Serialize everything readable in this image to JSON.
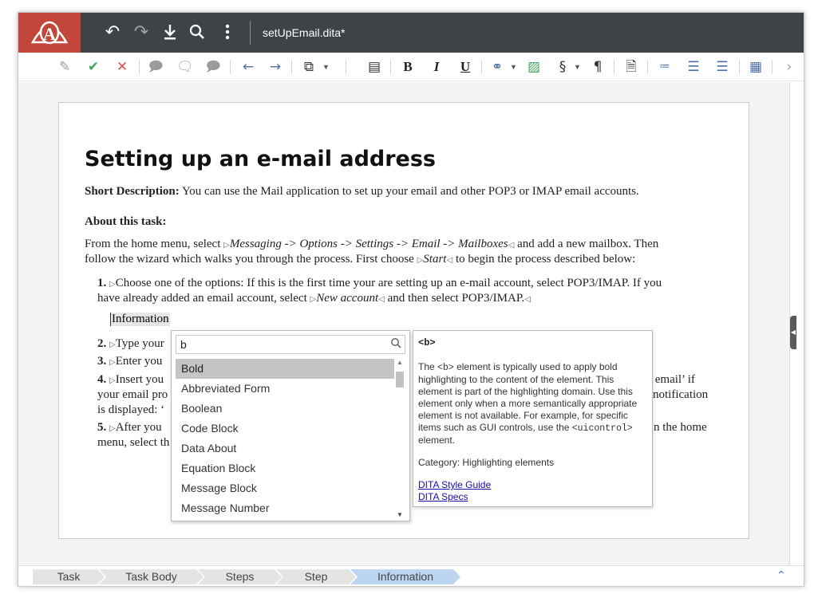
{
  "header": {
    "doc_title": "setUpEmail.dita*",
    "icons": [
      "logo-icon",
      "undo-icon",
      "redo-icon",
      "download-icon",
      "search-icon",
      "more-vertical-icon"
    ]
  },
  "toolbar": {
    "icons": [
      "review-icon",
      "accept-icon",
      "reject-icon",
      "comment-add-icon",
      "comment-edit-icon",
      "comment-remove-icon",
      "arrow-left-icon",
      "arrow-right-icon",
      "copy-icon",
      "outline-icon",
      "bold-icon",
      "italic-icon",
      "underline-icon",
      "link-icon",
      "image-icon",
      "section-icon",
      "paragraph-icon",
      "conref-icon",
      "list-item-icon",
      "unordered-list-icon",
      "ordered-list-icon",
      "table-icon",
      "more-right-icon"
    ],
    "bold_label": "B",
    "italic_label": "I",
    "underline_label": "U"
  },
  "document": {
    "title": "Setting up an e-mail address",
    "shortdesc_label": "Short Description:",
    "shortdesc_text": "You can use the Mail application to set up your email and other POP3 or IMAP email accounts.",
    "about_label": "About this task:",
    "about_line1_a": "From the home menu, select",
    "about_path": "Messaging -> Options -> Settings -> Email -> Mailboxes",
    "about_line1_b": "and add a new mailbox. Then",
    "about_line2_a": "follow the wizard which walks you through the process. First choose",
    "about_start": "Start",
    "about_line2_b": "to begin the process described below:",
    "step1_num": "1.",
    "step1_line1": "Choose one of the options: If this is the first time your are setting up an e-mail account, select POP3/IMAP. If you",
    "step1_line2_a": "have already added an email account, select",
    "step1_new_account": "New account",
    "step1_line2_b": "and then select POP3/IMAP.",
    "info_tag": "Information",
    "step2_num": "2.",
    "step2_text": "Type your",
    "step3_num": "3.",
    "step3_text": "Enter you",
    "step4_num": "4.",
    "step4_line1_a": "Insert you",
    "step4_line1_b": "ail email’ if",
    "step4_line2_a": "your email pro",
    "step4_line2_b": "notification",
    "step4_line3": "is displayed: ‘",
    "step5_num": "5.",
    "step5_line1_a": "After you",
    "step5_line1_b": "n the home",
    "step5_line2": "menu, select th"
  },
  "autocomplete": {
    "query": "b",
    "items": [
      "Bold",
      "Abbreviated Form",
      "Boolean",
      "Code Block",
      "Data About",
      "Equation Block",
      "Message Block",
      "Message Number"
    ],
    "selected_index": 0
  },
  "tooltip": {
    "tag": "<b>",
    "desc_1": "The ",
    "desc_code1": "<b>",
    "desc_2": " element is typically used to apply bold highlighting to the content of the element. This element is part of the highlighting domain. Use this element only when a more semantically appropriate element is not available. For example, for specific items such as GUI controls, use the ",
    "desc_code2": "<uicontrol>",
    "desc_3": " element.",
    "category": "Category: Highlighting elements",
    "link1": "DITA Style Guide",
    "link2": "DITA Specs"
  },
  "breadcrumb": [
    "Task",
    "Task Body",
    "Steps",
    "Step",
    "Information"
  ],
  "colors": {
    "header_bg": "#3e4347",
    "logo_bg": "#c2473a",
    "active_crumb": "#bcd6f2",
    "selected_item": "#c4c4c4"
  }
}
